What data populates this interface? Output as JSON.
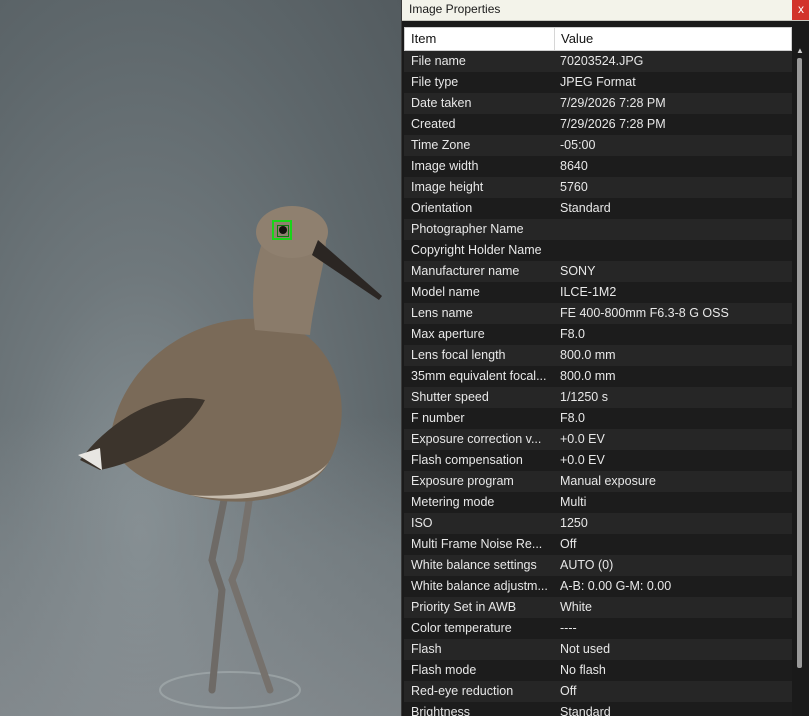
{
  "window": {
    "title": "Image Properties",
    "close_label": "x"
  },
  "table": {
    "headers": {
      "item": "Item",
      "value": "Value"
    },
    "rows": [
      {
        "item": "File name",
        "value": "70203524.JPG"
      },
      {
        "item": "File type",
        "value": "JPEG Format"
      },
      {
        "item": "Date taken",
        "value": "7/29/2026 7:28 PM"
      },
      {
        "item": "Created",
        "value": "7/29/2026 7:28 PM"
      },
      {
        "item": "Time Zone",
        "value": "-05:00"
      },
      {
        "item": "Image width",
        "value": "8640"
      },
      {
        "item": "Image height",
        "value": "5760"
      },
      {
        "item": "Orientation",
        "value": "Standard"
      },
      {
        "item": "Photographer Name",
        "value": ""
      },
      {
        "item": "Copyright Holder Name",
        "value": ""
      },
      {
        "item": "Manufacturer name",
        "value": "SONY"
      },
      {
        "item": "Model name",
        "value": "ILCE-1M2"
      },
      {
        "item": "Lens name",
        "value": "FE 400-800mm F6.3-8 G OSS"
      },
      {
        "item": "Max aperture",
        "value": "F8.0"
      },
      {
        "item": "Lens focal length",
        "value": "800.0 mm"
      },
      {
        "item": "35mm equivalent focal...",
        "value": "800.0 mm"
      },
      {
        "item": "Shutter speed",
        "value": "1/1250 s"
      },
      {
        "item": "F number",
        "value": "F8.0"
      },
      {
        "item": "Exposure correction v...",
        "value": "+0.0 EV"
      },
      {
        "item": "Flash compensation",
        "value": "+0.0 EV"
      },
      {
        "item": "Exposure program",
        "value": "Manual exposure"
      },
      {
        "item": "Metering mode",
        "value": "Multi"
      },
      {
        "item": "ISO",
        "value": "1250"
      },
      {
        "item": "Multi Frame Noise Re...",
        "value": "Off"
      },
      {
        "item": "White balance settings",
        "value": "AUTO (0)"
      },
      {
        "item": "White balance adjustm...",
        "value": "A-B: 0.00 G-M: 0.00"
      },
      {
        "item": "Priority Set in AWB",
        "value": "White"
      },
      {
        "item": "Color temperature",
        "value": "----"
      },
      {
        "item": "Flash",
        "value": "Not used"
      },
      {
        "item": "Flash mode",
        "value": "No flash"
      },
      {
        "item": "Red-eye reduction",
        "value": "Off"
      },
      {
        "item": "Brightness",
        "value": "Standard"
      }
    ]
  },
  "colors": {
    "focus_frame": "#19d419",
    "close_button": "#d2342b",
    "titlebar": "#f3f3ea"
  }
}
